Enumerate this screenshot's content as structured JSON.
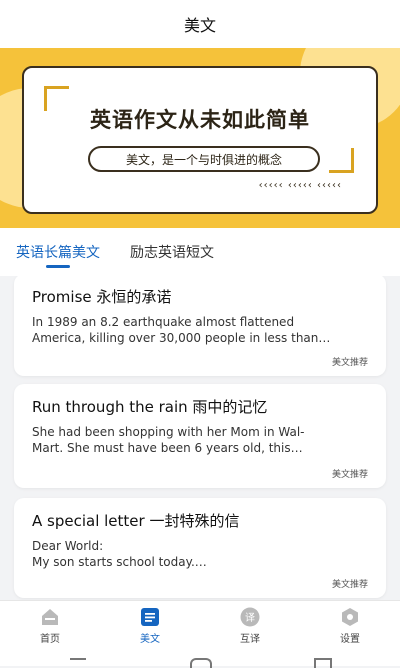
{
  "header": {
    "title": "美文"
  },
  "banner": {
    "headline": "英语作文从未如此简单",
    "tagline": "美文，是一个与时俱进的概念",
    "arrows": "‹‹‹‹‹  ‹‹‹‹‹  ‹‹‹‹‹"
  },
  "tabs": [
    {
      "label": "英语长篇美文"
    },
    {
      "label": "励志英语短文"
    }
  ],
  "articles": [
    {
      "title": "Promise 永恒的承诺",
      "excerpt": "        In 1989 an 8.2 earthquake almost flattened\nAmerica, killing over 30,000 people in less than…",
      "tag": "美文推荐"
    },
    {
      "title": "Run through the rain 雨中的记忆",
      "excerpt": "        She had been shopping with her Mom in Wal-\nMart. She must have been 6 years old, this…",
      "tag": "美文推荐"
    },
    {
      "title": "A special letter 一封特殊的信",
      "excerpt": "Dear World:\n        My son starts school today.…",
      "tag": "美文推荐"
    }
  ],
  "nav": [
    {
      "label": "首页",
      "icon": "home-icon"
    },
    {
      "label": "美文",
      "icon": "article-icon"
    },
    {
      "label": "互译",
      "icon": "translate-icon",
      "glyph": "译"
    },
    {
      "label": "设置",
      "icon": "settings-icon"
    }
  ],
  "colors": {
    "accent": "#1565c0",
    "banner": "#f5c23a"
  }
}
